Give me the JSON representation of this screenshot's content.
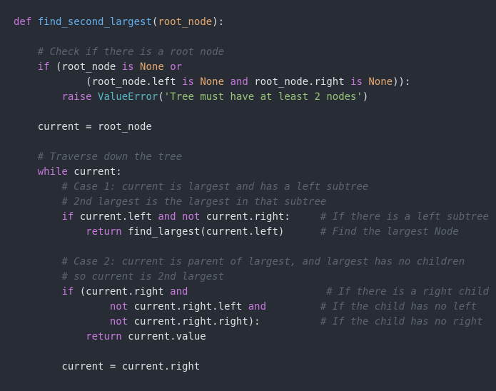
{
  "colors": {
    "background": "#282c34",
    "keyword": "#c678dd",
    "function": "#61afef",
    "parameter": "#e5a870",
    "comment": "#5c6370",
    "constant": "#e5a870",
    "class": "#56b6c2",
    "string": "#98c379",
    "plain": "#dcdfe4"
  },
  "code": {
    "lines": [
      [
        [
          "kw",
          "def"
        ],
        [
          "pl",
          " "
        ],
        [
          "fn",
          "find_second_largest"
        ],
        [
          "pl",
          "("
        ],
        [
          "pa",
          "root_node"
        ],
        [
          "pl",
          "):"
        ]
      ],
      [],
      [
        [
          "pl",
          "    "
        ],
        [
          "co",
          "# Check if there is a root node"
        ]
      ],
      [
        [
          "pl",
          "    "
        ],
        [
          "kw",
          "if"
        ],
        [
          "pl",
          " (root_node "
        ],
        [
          "kw",
          "is"
        ],
        [
          "pl",
          " "
        ],
        [
          "cn",
          "None"
        ],
        [
          "pl",
          " "
        ],
        [
          "kw",
          "or"
        ]
      ],
      [
        [
          "pl",
          "            (root_node.left "
        ],
        [
          "kw",
          "is"
        ],
        [
          "pl",
          " "
        ],
        [
          "cn",
          "None"
        ],
        [
          "pl",
          " "
        ],
        [
          "kw",
          "and"
        ],
        [
          "pl",
          " root_node.right "
        ],
        [
          "kw",
          "is"
        ],
        [
          "pl",
          " "
        ],
        [
          "cn",
          "None"
        ],
        [
          "pl",
          "))"
        ],
        [
          "pl",
          ":"
        ]
      ],
      [
        [
          "pl",
          "        "
        ],
        [
          "kw",
          "raise"
        ],
        [
          "pl",
          " "
        ],
        [
          "cl",
          "ValueError"
        ],
        [
          "pl",
          "("
        ],
        [
          "st",
          "'Tree must have at least 2 nodes'"
        ],
        [
          "pl",
          ")"
        ]
      ],
      [],
      [
        [
          "pl",
          "    current = root_node"
        ]
      ],
      [],
      [
        [
          "pl",
          "    "
        ],
        [
          "co",
          "# Traverse down the tree"
        ]
      ],
      [
        [
          "pl",
          "    "
        ],
        [
          "kw",
          "while"
        ],
        [
          "pl",
          " current:"
        ]
      ],
      [
        [
          "pl",
          "        "
        ],
        [
          "co",
          "# Case 1: current is largest and has a left subtree"
        ]
      ],
      [
        [
          "pl",
          "        "
        ],
        [
          "co",
          "# 2nd largest is the largest in that subtree"
        ]
      ],
      [
        [
          "pl",
          "        "
        ],
        [
          "kw",
          "if"
        ],
        [
          "pl",
          " current.left "
        ],
        [
          "kw",
          "and"
        ],
        [
          "pl",
          " "
        ],
        [
          "kw",
          "not"
        ],
        [
          "pl",
          " current.right:     "
        ],
        [
          "co",
          "# If there is a left subtree"
        ]
      ],
      [
        [
          "pl",
          "            "
        ],
        [
          "kw",
          "return"
        ],
        [
          "pl",
          " find_largest(current.left)      "
        ],
        [
          "co",
          "# Find the largest Node"
        ]
      ],
      [],
      [
        [
          "pl",
          "        "
        ],
        [
          "co",
          "# Case 2: current is parent of largest, and largest has no children"
        ]
      ],
      [
        [
          "pl",
          "        "
        ],
        [
          "co",
          "# so current is 2nd largest"
        ]
      ],
      [
        [
          "pl",
          "        "
        ],
        [
          "kw",
          "if"
        ],
        [
          "pl",
          " (current.right "
        ],
        [
          "kw",
          "and"
        ],
        [
          "pl",
          "                       "
        ],
        [
          "co",
          "# If there is a right child"
        ]
      ],
      [
        [
          "pl",
          "                "
        ],
        [
          "kw",
          "not"
        ],
        [
          "pl",
          " current.right.left "
        ],
        [
          "kw",
          "and"
        ],
        [
          "pl",
          "         "
        ],
        [
          "co",
          "# If the child has no left"
        ]
      ],
      [
        [
          "pl",
          "                "
        ],
        [
          "kw",
          "not"
        ],
        [
          "pl",
          " current.right.right):          "
        ],
        [
          "co",
          "# If the child has no right"
        ]
      ],
      [
        [
          "pl",
          "            "
        ],
        [
          "kw",
          "return"
        ],
        [
          "pl",
          " current.value"
        ]
      ],
      [],
      [
        [
          "pl",
          "        current = current.right"
        ]
      ]
    ]
  }
}
